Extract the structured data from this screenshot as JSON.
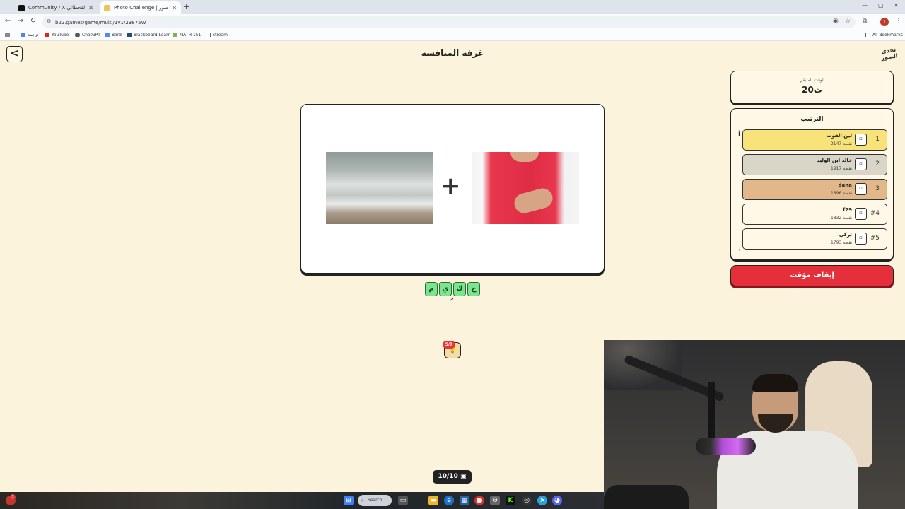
{
  "browser": {
    "tabs": [
      {
        "title": "Community / X الوليد القحطاني",
        "active": false
      },
      {
        "title": "Photo Challenge | تحدي الصور",
        "active": true
      }
    ],
    "new_tab": "+",
    "url": "b22.games/game/multi/1v1/23875W",
    "bookmarks": [
      "ترجمة",
      "YouTube",
      "ChatGPT",
      "Bard",
      "Blackboard Learn",
      "MATH 151",
      "stream"
    ],
    "all_bookmarks": "All Bookmarks",
    "profile_initial": "I"
  },
  "game": {
    "title": "غرفة المنافسة",
    "logo_text": "تحدي الصور",
    "time_label": "الوقت المتبقي",
    "time_value": "20ث",
    "ranking_title": "الترتيب",
    "players": [
      {
        "rank": "1",
        "name": "لين القوت",
        "points": "2147 نقطة",
        "color": "#f7e37a"
      },
      {
        "rank": "2",
        "name": "خالد ابن الوليد",
        "points": "1917 نقطة",
        "color": "#d9d6c8"
      },
      {
        "rank": "3",
        "name": "dana",
        "points": "1896 نقطة",
        "color": "#e2b88a"
      },
      {
        "rank": "#4",
        "name": "f29",
        "points": "1832 نقطة",
        "color": "#fff8e6"
      },
      {
        "rank": "#5",
        "name": "تركي",
        "points": "1793 نقطة",
        "color": "#fff8e6"
      }
    ],
    "stop_timer": "إيقاف مؤقت",
    "plus": "+",
    "letters": [
      "م",
      "ي",
      "ك",
      "ح"
    ],
    "hint_badge": "5/7",
    "counter": "10/10"
  },
  "taskbar": {
    "search_label": "Search",
    "notification_count": "3"
  }
}
